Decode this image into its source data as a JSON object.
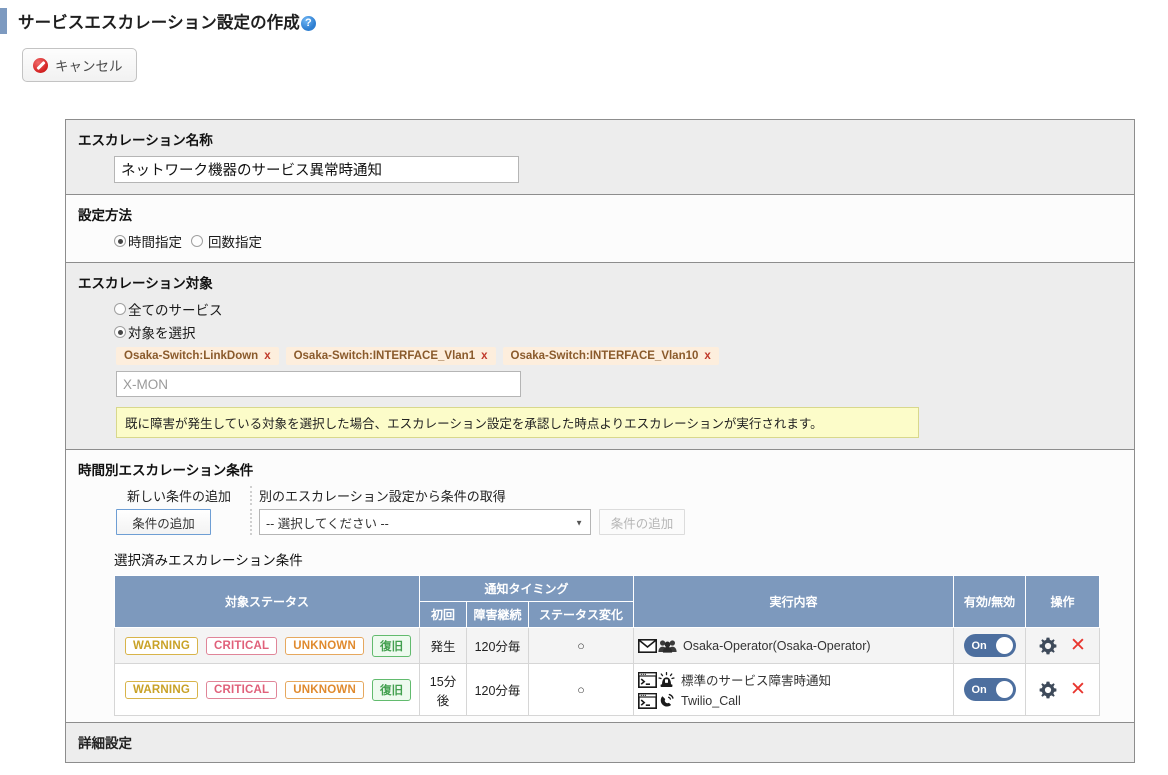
{
  "header": {
    "title": "サービスエスカレーション設定の作成",
    "help_icon": "help-circle-icon",
    "help_glyph": "?"
  },
  "toolbar": {
    "cancel_label": "キャンセル",
    "cancel_icon": "deny-icon"
  },
  "sections": {
    "name": {
      "title": "エスカレーション名称",
      "input_value": "ネットワーク機器のサービス異常時通知",
      "input_placeholder": ""
    },
    "method": {
      "title": "設定方法",
      "option_time": "時間指定",
      "option_count": "回数指定",
      "selected": "時間指定"
    },
    "target": {
      "title": "エスカレーション対象",
      "option_all": "全てのサービス",
      "option_select": "対象を選択",
      "selected": "対象を選択",
      "tags": [
        {
          "label": "Osaka-Switch:LinkDown",
          "remove": "x"
        },
        {
          "label": "Osaka-Switch:INTERFACE_Vlan1",
          "remove": "x"
        },
        {
          "label": "Osaka-Switch:INTERFACE_Vlan10",
          "remove": "x"
        }
      ],
      "search_value": "",
      "search_placeholder": "X-MON",
      "notice": "既に障害が発生している対象を選択した場合、エスカレーション設定を承認した時点よりエスカレーションが実行されます。"
    },
    "conditions": {
      "title": "時間別エスカレーション条件",
      "head_new": "新しい条件の追加",
      "head_import": "別のエスカレーション設定から条件の取得",
      "btn_add": "条件の追加",
      "select_value": "-- 選択してください --",
      "select_arrow": "chevron-down-icon",
      "btn_add_disabled": "条件の追加",
      "subtitle": "選択済みエスカレーション条件"
    },
    "advanced": {
      "title": "詳細設定"
    }
  },
  "table": {
    "headers": {
      "status": "対象ステータス",
      "timing": "通知タイミング",
      "timing_first": "初回",
      "timing_continue": "障害継続",
      "timing_change": "ステータス変化",
      "action": "実行内容",
      "enabled": "有効/無効",
      "ops": "操作"
    },
    "rows": [
      {
        "badges": [
          {
            "text": "WARNING",
            "kind": "warning"
          },
          {
            "text": "CRITICAL",
            "kind": "critical"
          },
          {
            "text": "UNKNOWN",
            "kind": "unknown"
          },
          {
            "text": "復旧",
            "kind": "recover"
          }
        ],
        "first": "発生",
        "continue": "120分毎",
        "change": "○",
        "actions": [
          {
            "icons": [
              "mail-icon",
              "group-icon"
            ],
            "text": "Osaka-Operator(Osaka-Operator)"
          }
        ],
        "enabled_label": "On",
        "gear_icon": "gear-icon",
        "delete_icon": "close-icon"
      },
      {
        "badges": [
          {
            "text": "WARNING",
            "kind": "warning"
          },
          {
            "text": "CRITICAL",
            "kind": "critical"
          },
          {
            "text": "UNKNOWN",
            "kind": "unknown"
          },
          {
            "text": "復旧",
            "kind": "recover"
          }
        ],
        "first": "15分後",
        "continue": "120分毎",
        "change": "○",
        "actions": [
          {
            "icons": [
              "terminal-icon",
              "alarm-icon"
            ],
            "text": "標準のサービス障害時通知"
          },
          {
            "icons": [
              "terminal-icon",
              "phone-icon"
            ],
            "text": "Twilio_Call"
          }
        ],
        "enabled_label": "On",
        "gear_icon": "gear-icon",
        "delete_icon": "close-icon"
      }
    ]
  },
  "colors": {
    "accent": "#7d9ac0",
    "table_header": "#7d99bd",
    "toggle_on": "#4d6f9f",
    "notice_bg": "#fcfcc9",
    "tag_bg": "#fdeedd",
    "delete": "#e8352e"
  }
}
